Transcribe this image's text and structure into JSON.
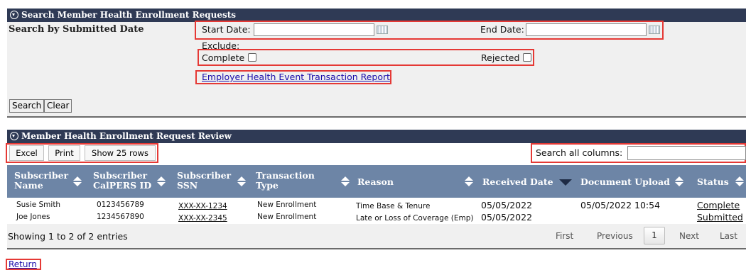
{
  "search_panel": {
    "title": "Search Member Health Enrollment Requests",
    "section_label": "Search by Submitted Date",
    "start_date_label": "Start Date:",
    "start_date_value": "",
    "end_date_label": "End Date:",
    "end_date_value": "",
    "exclude_label": "Exclude:",
    "complete_label": "Complete",
    "rejected_label": "Rejected",
    "report_link": "Employer Health Event Transaction Report",
    "search_button": "Search",
    "clear_button": "Clear"
  },
  "review_panel": {
    "title": "Member Health Enrollment Request Review",
    "toolbar": {
      "excel": "Excel",
      "print": "Print",
      "show_rows": "Show 25 rows"
    },
    "search_all_label": "Search all columns:",
    "search_all_value": "",
    "columns": [
      [
        "Subscriber",
        "Name"
      ],
      [
        "Subscriber",
        "CalPERS ID"
      ],
      [
        "Subscriber",
        "SSN"
      ],
      [
        "Transaction",
        "Type"
      ],
      [
        "Reason"
      ],
      [
        "Received Date"
      ],
      [
        "Document Upload"
      ],
      [
        "Status"
      ]
    ],
    "rows": [
      {
        "name": "Susie Smith",
        "calpers_id": "0123456789",
        "ssn": "XXX-XX-1234",
        "type": "New Enrollment",
        "reason": "Time Base & Tenure",
        "received": "05/05/2022",
        "upload": "05/05/2022 10:54",
        "status": "Complete"
      },
      {
        "name": "Joe Jones",
        "calpers_id": "1234567890",
        "ssn": "XXX-XX-2345",
        "type": "New Enrollment",
        "reason": "Late or Loss of Coverage (Emp)",
        "received": "05/05/2022",
        "upload": "",
        "status": "Submitted"
      }
    ],
    "info": "Showing 1 to 2 of 2 entries",
    "pager": {
      "first": "First",
      "previous": "Previous",
      "page": "1",
      "next": "Next",
      "last": "Last"
    }
  },
  "return_link": "Return",
  "colors": {
    "header_bar": "#2f3a55",
    "table_header": "#6d85a6",
    "highlight": "#e53935",
    "link": "#1a0dab"
  }
}
